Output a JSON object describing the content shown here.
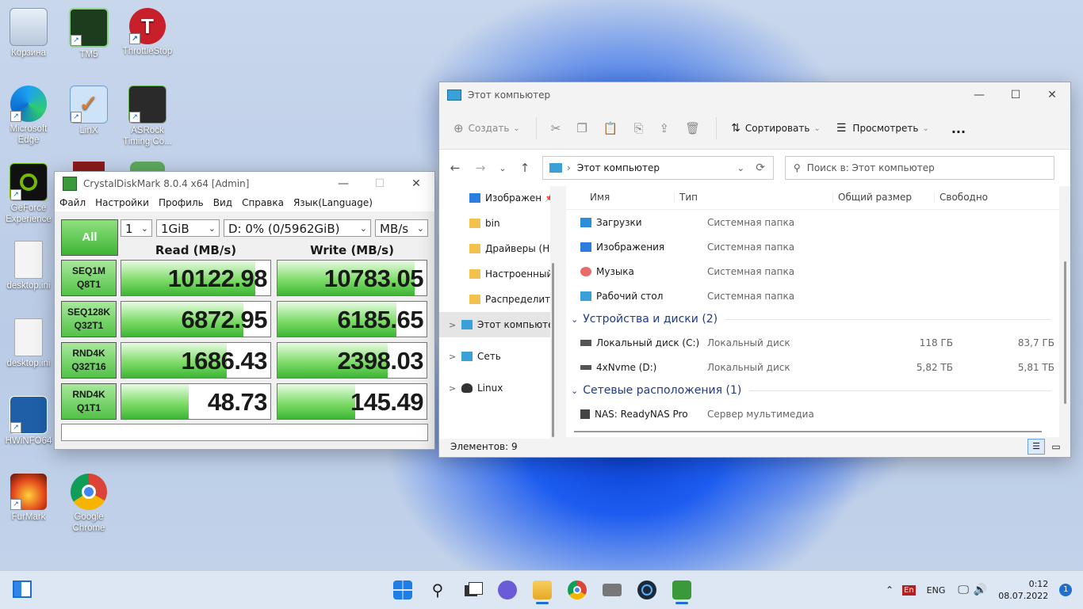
{
  "desktop": {
    "icons": [
      {
        "label": "Корзина"
      },
      {
        "label": "TM5"
      },
      {
        "label": "ThrottleStop"
      },
      {
        "label": "Microsoft Edge"
      },
      {
        "label": "LinX"
      },
      {
        "label": "ASRock Timing Co..."
      },
      {
        "label": "GeForce Experience"
      },
      {
        "label": "desktop.ini"
      },
      {
        "label": "desktop.ini"
      },
      {
        "label": "HWiNFO64"
      },
      {
        "label": "FurMark"
      },
      {
        "label": "Google Chrome"
      }
    ]
  },
  "cdm": {
    "title": "CrystalDiskMark 8.0.4 x64 [Admin]",
    "menu": [
      "Файл",
      "Настройки",
      "Профиль",
      "Вид",
      "Справка",
      "Язык(Language)"
    ],
    "count": "1",
    "size": "1GiB",
    "drive": "D: 0% (0/5962GiB)",
    "unit": "MB/s",
    "all_label": "All",
    "read_header": "Read (MB/s)",
    "write_header": "Write (MB/s)",
    "max_scale": 12000,
    "tests": [
      {
        "name": "SEQ1M",
        "sub": "Q8T1",
        "read": "10122.98",
        "write": "10783.05",
        "read_fill": 0.9,
        "write_fill": 0.92
      },
      {
        "name": "SEQ128K",
        "sub": "Q32T1",
        "read": "6872.95",
        "write": "6185.65",
        "read_fill": 0.82,
        "write_fill": 0.8
      },
      {
        "name": "RND4K",
        "sub": "Q32T16",
        "read": "1686.43",
        "write": "2398.03",
        "read_fill": 0.71,
        "write_fill": 0.74
      },
      {
        "name": "RND4K",
        "sub": "Q1T1",
        "read": "48.73",
        "write": "145.49",
        "read_fill": 0.45,
        "write_fill": 0.52
      }
    ]
  },
  "explorer": {
    "title": "Этот компьютер",
    "toolbar": {
      "create": "Создать",
      "sort": "Сортировать",
      "view": "Просмотреть",
      "more": "..."
    },
    "address": "Этот компьютер",
    "search_placeholder": "Поиск в: Этот компьютер",
    "nav": [
      {
        "label": "Изображен",
        "color": "#2b7de0",
        "chev": ""
      },
      {
        "label": "bin",
        "color": "#f2c14e",
        "chev": ""
      },
      {
        "label": "Драйверы (Hu",
        "color": "#f2c14e",
        "chev": ""
      },
      {
        "label": "Настроенный",
        "color": "#f2c14e",
        "chev": ""
      },
      {
        "label": "Распределить",
        "color": "#f2c14e",
        "chev": ""
      },
      {
        "label": "Этот компьютер",
        "color": "#3aa0d8",
        "chev": ">"
      },
      {
        "label": "Сеть",
        "color": "#3aa0d8",
        "chev": ">"
      },
      {
        "label": "Linux",
        "color": "#333333",
        "chev": ">"
      }
    ],
    "columns": {
      "name": "Имя",
      "type": "Тип",
      "total": "Общий размер",
      "free": "Свободно"
    },
    "folders": [
      {
        "name": "Загрузки",
        "type": "Системная папка",
        "color": "#2a8fd8"
      },
      {
        "name": "Изображения",
        "type": "Системная папка",
        "color": "#2b7de0"
      },
      {
        "name": "Музыка",
        "type": "Системная папка",
        "color": "#e86a6a"
      },
      {
        "name": "Рабочий стол",
        "type": "Системная папка",
        "color": "#3aa0d8"
      }
    ],
    "group_devices": "Устройства и диски (2)",
    "drives": [
      {
        "name": "Локальный диск (C:)",
        "type": "Локальный диск",
        "total": "118 ГБ",
        "free": "83,7 ГБ"
      },
      {
        "name": "4xNvme (D:)",
        "type": "Локальный диск",
        "total": "5,82 ТБ",
        "free": "5,81 ТБ"
      }
    ],
    "group_network": "Сетевые расположения (1)",
    "network": [
      {
        "name": "NAS: ReadyNAS Pro",
        "type": "Сервер мультимедиа"
      }
    ],
    "status": "Элементов: 9"
  },
  "taskbar": {
    "lang_badge": "En",
    "lang": "ENG",
    "time": "0:12",
    "date": "08.07.2022",
    "notif_count": "1"
  }
}
